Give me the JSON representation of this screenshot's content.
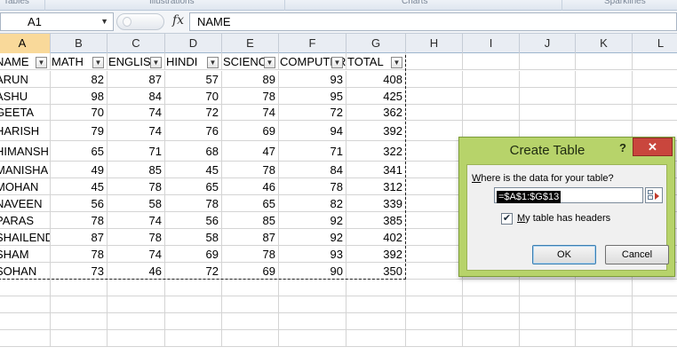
{
  "ribbon": {
    "groups": [
      "Tables",
      "Illustrations",
      "Charts",
      "Sparklines"
    ]
  },
  "formula_bar": {
    "name_box": "A1",
    "fx_label": "fx",
    "formula": "NAME"
  },
  "columns": [
    "A",
    "B",
    "C",
    "D",
    "E",
    "F",
    "G",
    "H",
    "I",
    "J",
    "K",
    "L"
  ],
  "table": {
    "headers": [
      "NAME",
      "MATH",
      "ENGLISH",
      "HINDI",
      "SCIENCE",
      "COMPUTER",
      "TOTAL"
    ],
    "rows": [
      [
        "ARUN",
        82,
        87,
        57,
        89,
        93,
        408
      ],
      [
        "ASHU",
        98,
        84,
        70,
        78,
        95,
        425
      ],
      [
        "GEETA",
        70,
        74,
        72,
        74,
        72,
        362
      ],
      [
        "HARISH",
        79,
        74,
        76,
        69,
        94,
        392
      ],
      [
        "HIMANSHU",
        65,
        71,
        68,
        47,
        71,
        322
      ],
      [
        "MANISHA",
        49,
        85,
        45,
        78,
        84,
        341
      ],
      [
        "MOHAN",
        45,
        78,
        65,
        46,
        78,
        312
      ],
      [
        "NAVEEN",
        56,
        58,
        78,
        65,
        82,
        339
      ],
      [
        "PARAS",
        78,
        74,
        56,
        85,
        92,
        385
      ],
      [
        "SHAILENDRA",
        87,
        78,
        58,
        87,
        92,
        402
      ],
      [
        "SHAM",
        78,
        74,
        69,
        78,
        93,
        392
      ],
      [
        "SOHAN",
        73,
        46,
        72,
        69,
        90,
        350
      ]
    ]
  },
  "dialog": {
    "title": "Create Table",
    "help": "?",
    "close": "✕",
    "question": "Where is the data for your table?",
    "range": "=$A$1:$G$13",
    "checkbox_checked": true,
    "checkbox_label": "My table has headers",
    "ok": "OK",
    "cancel": "Cancel"
  }
}
